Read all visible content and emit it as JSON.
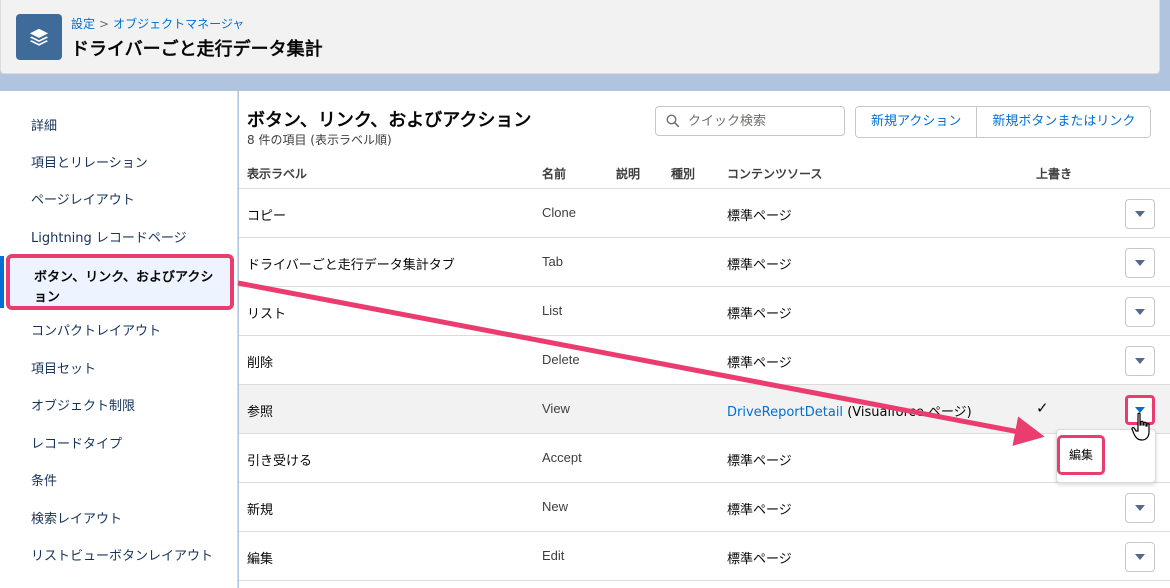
{
  "header": {
    "breadcrumb": [
      "設定",
      "オブジェクトマネージャ"
    ],
    "breadcrumb_sep": ">",
    "title": "ドライバーごと走行データ集計",
    "icon": "layers-icon"
  },
  "sidebar": {
    "items": [
      {
        "label": "詳細"
      },
      {
        "label": "項目とリレーション"
      },
      {
        "label": "ページレイアウト"
      },
      {
        "label": "Lightning レコードページ"
      },
      {
        "label": "ボタン、リンク、およびアクション",
        "active": true
      },
      {
        "label": "コンパクトレイアウト"
      },
      {
        "label": "項目セット"
      },
      {
        "label": "オブジェクト制限"
      },
      {
        "label": "レコードタイプ"
      },
      {
        "label": "条件"
      },
      {
        "label": "検索レイアウト"
      },
      {
        "label": "リストビューボタンレイアウト"
      }
    ]
  },
  "main": {
    "title": "ボタン、リンク、およびアクション",
    "subtitle": "8 件の項目 (表示ラベル順)",
    "search_placeholder": "クイック検索",
    "new_action_label": "新規アクション",
    "new_button_label": "新規ボタンまたはリンク",
    "columns": [
      "表示ラベル",
      "名前",
      "説明",
      "種別",
      "コンテンツソース",
      "上書き"
    ],
    "rows": [
      {
        "label": "コピー",
        "name": "Clone",
        "source": "標準ページ",
        "override": ""
      },
      {
        "label": "ドライバーごと走行データ集計タブ",
        "name": "Tab",
        "source": "標準ページ",
        "override": ""
      },
      {
        "label": "リスト",
        "name": "List",
        "source": "標準ページ",
        "override": ""
      },
      {
        "label": "削除",
        "name": "Delete",
        "source": "標準ページ",
        "override": ""
      },
      {
        "label": "参照",
        "name": "View",
        "source_link": "DriveReportDetail",
        "source_suffix": " (Visualforce ページ)",
        "override": "✓"
      },
      {
        "label": "引き受ける",
        "name": "Accept",
        "source": "標準ページ",
        "override": ""
      },
      {
        "label": "新規",
        "name": "New",
        "source": "標準ページ",
        "override": ""
      },
      {
        "label": "編集",
        "name": "Edit",
        "source": "標準ページ",
        "override": ""
      }
    ],
    "dropdown_item": "編集"
  },
  "colors": {
    "accent": "#0070d2",
    "highlight": "#ea3c6f",
    "header_icon_bg": "#3e6b9a",
    "background": "#b0c4df"
  }
}
